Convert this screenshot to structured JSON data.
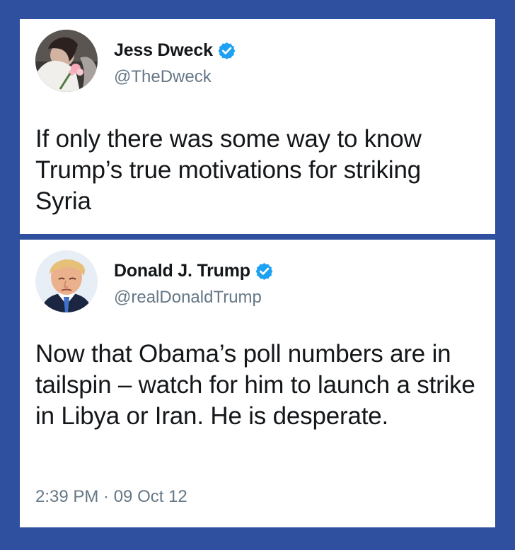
{
  "tweets": [
    {
      "display_name": "Jess Dweck",
      "handle": "@TheDweck",
      "verified": true,
      "avatar_icon": "avatar-woman-flowers",
      "text": "If only there was some way to know Trump’s true motivations for striking Syria"
    },
    {
      "display_name": "Donald J. Trump",
      "handle": "@realDonaldTrump",
      "verified": true,
      "avatar_icon": "avatar-man-portrait",
      "text": "Now that Obama’s poll numbers are in tailspin – watch for him to launch a strike in Libya or Iran.  He is desperate.",
      "timestamp": "2:39 PM · 09 Oct 12"
    }
  ],
  "colors": {
    "background": "#2f4f9f",
    "card": "#ffffff",
    "text_primary": "#14171a",
    "text_secondary": "#657786",
    "verified_blue": "#1da1f2"
  }
}
